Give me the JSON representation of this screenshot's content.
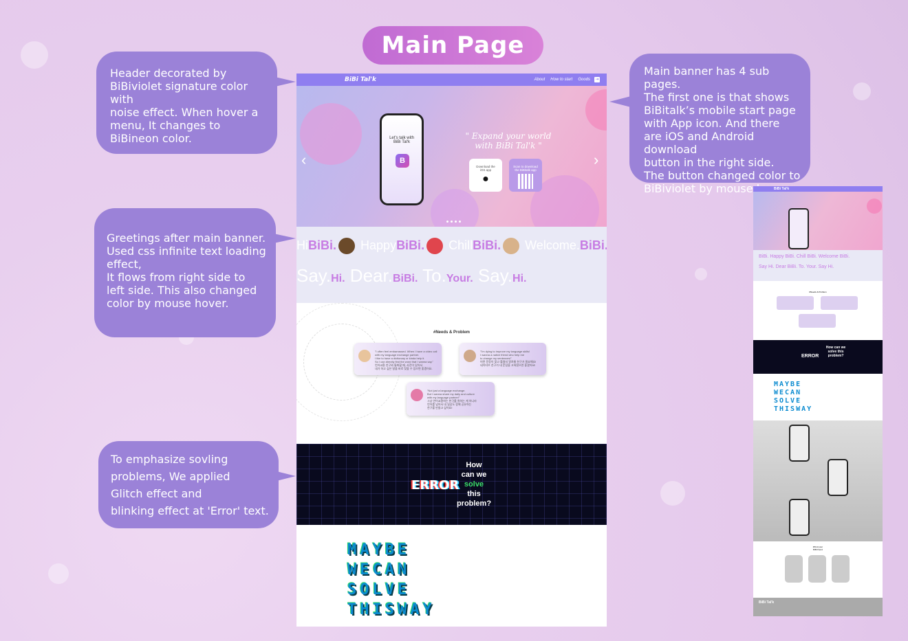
{
  "title": "Main Page",
  "notes": {
    "header": "Header decorated by\nBiBiviolet signature color with\nnoise effect. When hover a\nmenu, It changes to\nBiBineon color.",
    "banner": "Main banner has 4 sub pages.\nThe first one is that shows\nBiBitalk’s mobile start page\nwith App icon. And there\nare iOS and Android download\nbutton in the right side.\nThe button changed color to\nBiBiviolet by mouse hover.",
    "greetings": "Greetings after main banner.\nUsed css infinite text loading\neffect,\nIt flows from right side to\nleft side. This also changed\ncolor by mouse hover.",
    "error": "To emphasize sovling\nproblems, We applied\nGlitch effect and\nblinking effect at 'Error' text."
  },
  "page": {
    "header": {
      "logo": "BiBi Tal'k",
      "menu": [
        "About",
        "How to start",
        "Goods"
      ]
    },
    "banner": {
      "phone_text": "Let's talk with\nBiBi Tal'k",
      "app_icon": "B",
      "tagline": "\" Expand your world\nwith BiBi Tal'k \"",
      "ios_button": "Download the\niOS app",
      "android_button": "Scan to download\nthe BiBitalk app",
      "prev_icon": "chevron-left-icon",
      "next_icon": "chevron-right-icon"
    },
    "greetings": {
      "row1": [
        {
          "w": "Hi",
          "b": "BiBi."
        },
        {
          "w": "Happy",
          "b": "BiBi."
        },
        {
          "w": "Chill",
          "b": "BiBi."
        },
        {
          "w": "Welcome.",
          "b": "BiBi."
        }
      ],
      "row2": [
        {
          "w": "Say.",
          "b": "Hi."
        },
        {
          "w": "Dear.",
          "b": "BiBi."
        },
        {
          "w": "To.",
          "b": "Your."
        },
        {
          "w": "Say.",
          "b": "Hi."
        }
      ]
    },
    "needs": {
      "title": "#Needs & Problem",
      "cards": [
        "\"I often feel embarrassed. When I have a video call\nwith my language exchange partner.\nI like to have a dictionary or kinda help it.\nSo I can directly find the word that I wanna say.\"\n언어교환 친구와 통화할 때, 사전이 있어서\n내가 하고 싶은 말을 바로 찾을 수 있으면 좋겠어요.",
        "\"I'm dying to improve my language skills!\nI wanna a native friend who help me\nto change my sentences!\"\n어떤 문장이 맞고 틀렸지 알려줄 친구가 필요해요!\n네이티브 친구가 내 문장을 고쳐줬으면 좋겠어요!",
        "\"Not just a language exchange.\nBut I wanna share my daily and culture\nwith my language partner!\"\n그냥 언어교환하는 친구를 원하는 게 아니라\n언어를 넘어서 내 일상도 함께 공유하는\n친구를 만들고 싶어요!"
      ]
    },
    "error": {
      "word": "ERROR",
      "question": [
        "How",
        "can we",
        "solve",
        "this",
        "problem?"
      ]
    },
    "maybe": [
      "MAYBE",
      "WECAN",
      "SOLVE",
      "THISWAY"
    ]
  },
  "thumb": {
    "logo": "BiBi Tal'k",
    "greet1": "BiBi. Happy BiBi. Chill BiBi. Welcome BiBi.",
    "greet2": "Say Hi. Dear BiBi. To. Your. Say Hi.",
    "needs_title": "#Needs & Problem",
    "error": "ERROR",
    "question": "How can we solve this problem?",
    "maybe": [
      "MAYBE",
      "WECAN",
      "SOLVE",
      "THISWAY"
    ],
    "friends": "#Find your\nBiBi friend",
    "footer_logo": "BiBi Tal'k"
  },
  "colors": {
    "bibiviolet": "#8f7ef0",
    "note": "#9b82d8",
    "title_pill": "#c970d6",
    "bibineon": "#c77ce3"
  }
}
